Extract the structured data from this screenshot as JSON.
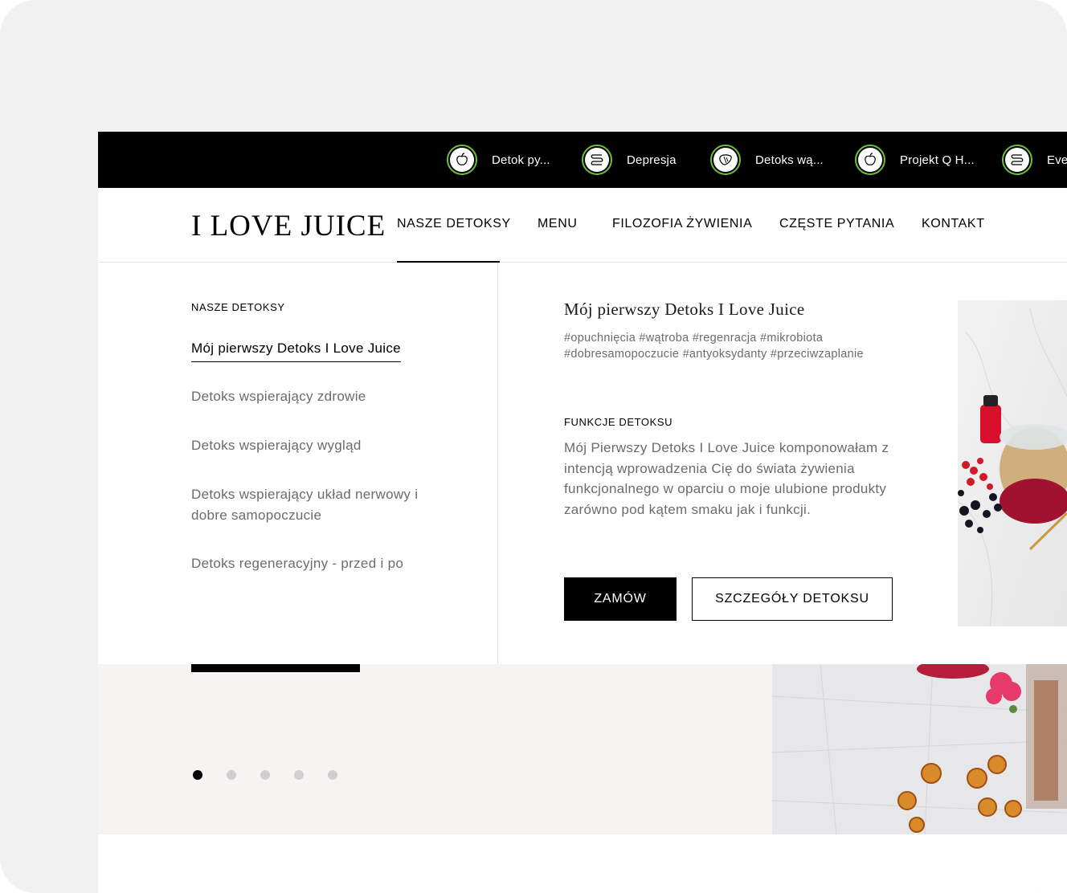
{
  "topbar": {
    "chips": [
      {
        "label": "Detok py...",
        "icon": "apple-icon"
      },
      {
        "label": "Depresja",
        "icon": "intestine-icon"
      },
      {
        "label": "Detoks wą...",
        "icon": "liver-icon"
      },
      {
        "label": "Projekt Q H...",
        "icon": "apple-icon"
      },
      {
        "label": "Eve",
        "icon": "intestine-icon"
      }
    ],
    "ring_color": "#6cbf3b"
  },
  "header": {
    "logo": "I LOVE JUICE",
    "nav": [
      {
        "label": "NASZE DETOKSY",
        "active": true
      },
      {
        "label": "MENU"
      },
      {
        "label": "FILOZOFIA ŻYWIENIA"
      },
      {
        "label": "CZĘSTE PYTANIA"
      },
      {
        "label": "KONTAKT"
      }
    ]
  },
  "dropdown": {
    "heading": "NASZE DETOKSY",
    "items": [
      {
        "label": "Mój pierwszy Detoks I Love Juice",
        "active": true
      },
      {
        "label": "Detoks wspierający zdrowie"
      },
      {
        "label": "Detoks wspierający wygląd"
      },
      {
        "label": "Detoks wspierający układ nerwowy i dobre samopoczucie"
      },
      {
        "label": "Detoks regeneracyjny - przed i po"
      }
    ],
    "detail": {
      "title": "Mój pierwszy Detoks I Love Juice",
      "tags": "#opuchnięcia #wątroba #regenracja #mikrobiota #dobresamopoczucie #antyoksydanty #przeciwzaplanie",
      "function_heading": "FUNKCJE DETOKSU",
      "function_text": "Mój Pierwszy Detoks I Love Juice komponowałam z intencją wprowadzenia Cię do świata żywienia funkcjonalnego w oparciu o moje ulubione produkty zarówno pod kątem smaku jak i funkcji.",
      "order_button": "ZAMÓW",
      "details_button": "SZCZEGÓŁY DETOKSU"
    }
  },
  "hero": {
    "slides_count": 5,
    "active_slide": 1
  }
}
